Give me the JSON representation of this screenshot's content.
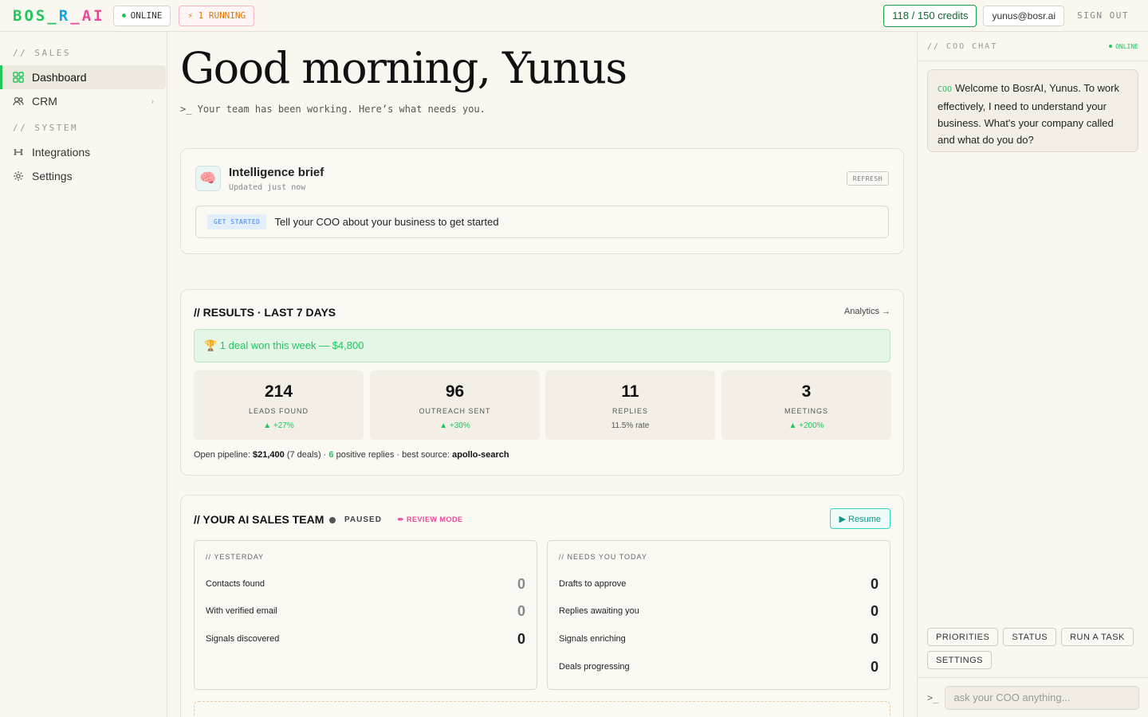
{
  "topbar": {
    "logo": {
      "part1": "BOS",
      "sep1": "_",
      "part2": "R",
      "sep2": "_",
      "part3": "AI"
    },
    "online": "ONLINE",
    "running": "⚡ 1 RUNNING",
    "credits": "118 / 150 credits",
    "email": "yunus@bosr.ai",
    "signout": "SIGN OUT"
  },
  "sidebar": {
    "section_sales": "// SALES",
    "section_system": "// SYSTEM",
    "items": [
      {
        "label": "Dashboard",
        "icon": "grid-icon"
      },
      {
        "label": "CRM",
        "icon": "users-icon"
      },
      {
        "label": "Integrations",
        "icon": "link-icon"
      },
      {
        "label": "Settings",
        "icon": "gear-icon"
      }
    ]
  },
  "main": {
    "greeting": "Good morning, Yunus",
    "subline": ">_ Your team has been working. Here’s what needs you.",
    "brief": {
      "icon": "🧠",
      "title": "Intelligence brief",
      "updated": "Updated just now",
      "refresh": "REFRESH",
      "badge": "GET STARTED",
      "text": "Tell your COO about your business to get started"
    },
    "results": {
      "title": "// RESULTS · LAST 7 DAYS",
      "analytics": "Analytics →",
      "deal_banner": "🏆 1 deal won this week — $4,800",
      "kpis": [
        {
          "value": "214",
          "label": "LEADS FOUND",
          "delta": "▲ +27%"
        },
        {
          "value": "96",
          "label": "OUTREACH SENT",
          "delta": "▲ +30%"
        },
        {
          "value": "11",
          "label": "REPLIES",
          "delta": "11.5% rate"
        },
        {
          "value": "3",
          "label": "MEETINGS",
          "delta": "▲ +200%"
        }
      ],
      "pipeline": {
        "prefix": "Open pipeline: ",
        "amount": "$21,400",
        "deals": " (7 deals) · ",
        "positive_count": "6",
        "positive_text": " positive replies · best source: ",
        "source": "apollo-search"
      }
    },
    "team": {
      "title": "// YOUR AI SALES TEAM",
      "status": "PAUSED",
      "review": "✏ REVIEW MODE",
      "resume": "▶ Resume",
      "yesterday": {
        "label": "// YESTERDAY",
        "rows": [
          {
            "label": "Contacts found",
            "value": "0"
          },
          {
            "label": "With verified email",
            "value": "0"
          },
          {
            "label": "Signals discovered",
            "value": "0"
          }
        ]
      },
      "today": {
        "label": "// NEEDS YOU TODAY",
        "rows": [
          {
            "label": "Drafts to approve",
            "value": "0"
          },
          {
            "label": "Replies awaiting you",
            "value": "0"
          },
          {
            "label": "Signals enriching",
            "value": "0"
          },
          {
            "label": "Deals progressing",
            "value": "0"
          }
        ]
      }
    }
  },
  "chat": {
    "title": "// COO CHAT",
    "online": "ONLINE",
    "message_tag": "COO",
    "message": "Welcome to BosrAI, Yunus. To work effectively, I need to understand your business. What's your company called and what do you do?",
    "quick": [
      "PRIORITIES",
      "STATUS",
      "RUN A TASK",
      "SETTINGS"
    ],
    "prompt": ">_",
    "placeholder": "ask your COO anything..."
  },
  "colors": {
    "accent": "#22c55e",
    "brand_blue": "#0ea5e9",
    "brand_pink": "#ec4899",
    "teal": "#0d9488"
  }
}
